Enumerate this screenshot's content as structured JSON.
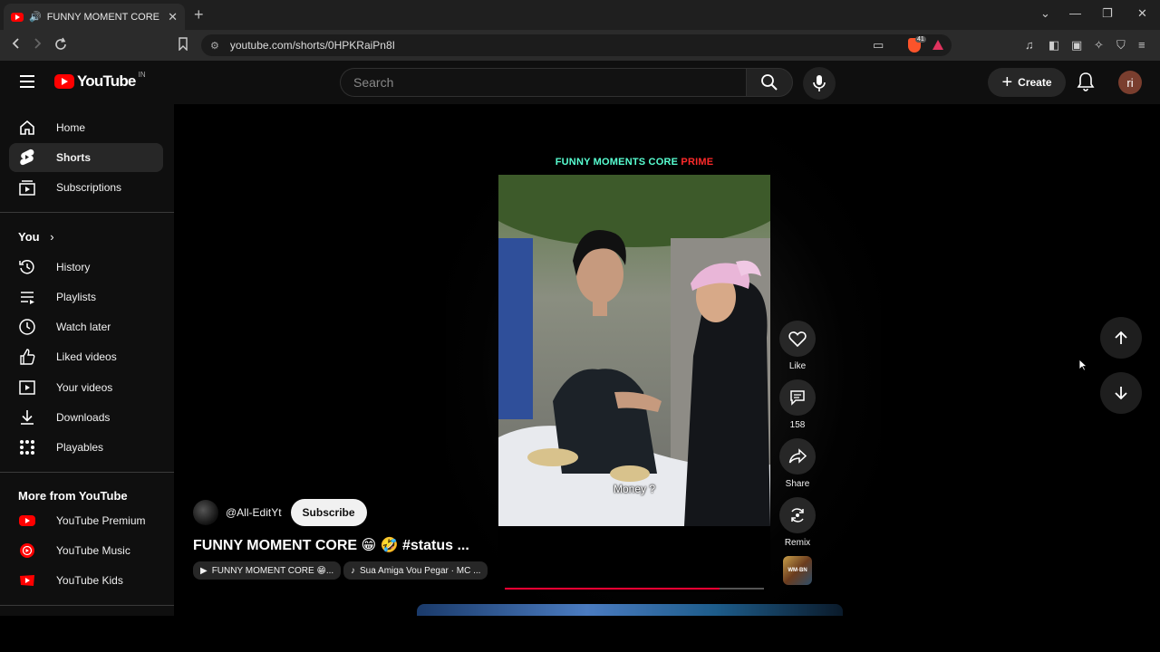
{
  "browser": {
    "tab_title": "FUNNY MOMENT CORE 😁🤣",
    "tab_close": "✕",
    "new_tab": "+",
    "url": "youtube.com/shorts/0HPKRaiPn8I",
    "brave_badge": "41"
  },
  "header": {
    "logo_text": "YouTube",
    "region": "IN",
    "search_placeholder": "Search",
    "create_label": "Create",
    "avatar_initials": "ri"
  },
  "sidebar": {
    "main_items": [
      {
        "label": "Home",
        "icon": "home-icon"
      },
      {
        "label": "Shorts",
        "icon": "shorts-icon",
        "active": true
      },
      {
        "label": "Subscriptions",
        "icon": "subscriptions-icon"
      }
    ],
    "you_heading": "You",
    "you_items": [
      {
        "label": "History",
        "icon": "history-icon"
      },
      {
        "label": "Playlists",
        "icon": "playlists-icon"
      },
      {
        "label": "Watch later",
        "icon": "clock-icon"
      },
      {
        "label": "Liked videos",
        "icon": "thumbs-up-icon"
      },
      {
        "label": "Your videos",
        "icon": "your-videos-icon"
      },
      {
        "label": "Downloads",
        "icon": "download-icon"
      },
      {
        "label": "Playables",
        "icon": "playables-icon"
      }
    ],
    "more_heading": "More from YouTube",
    "more_items": [
      {
        "label": "YouTube Premium",
        "icon": "youtube-premium-icon"
      },
      {
        "label": "YouTube Music",
        "icon": "youtube-music-icon"
      },
      {
        "label": "YouTube Kids",
        "icon": "youtube-kids-icon"
      }
    ]
  },
  "short": {
    "banner_part1": "FUNNY MOMENTS CORE ",
    "banner_part2": "PRIME",
    "subtitle": "Money ?",
    "progress_fraction": 0.83,
    "channel": "@All-EditYt",
    "subscribe_label": "Subscribe",
    "title": "FUNNY MOMENT CORE 😁 🤣 #status ...",
    "chip_playlist": "FUNNY MOMENT CORE 😁...",
    "chip_audio": "Sua Amiga Vou Pegar · MC ..."
  },
  "actions": {
    "like_label": "Like",
    "comments_count": "158",
    "share_label": "Share",
    "remix_label": "Remix",
    "remix_thumb_text": "WM·BN"
  },
  "colors": {
    "accent_red": "#ff0000",
    "banner_cyan": "#58ffd2",
    "progress_red": "#ff0033"
  }
}
